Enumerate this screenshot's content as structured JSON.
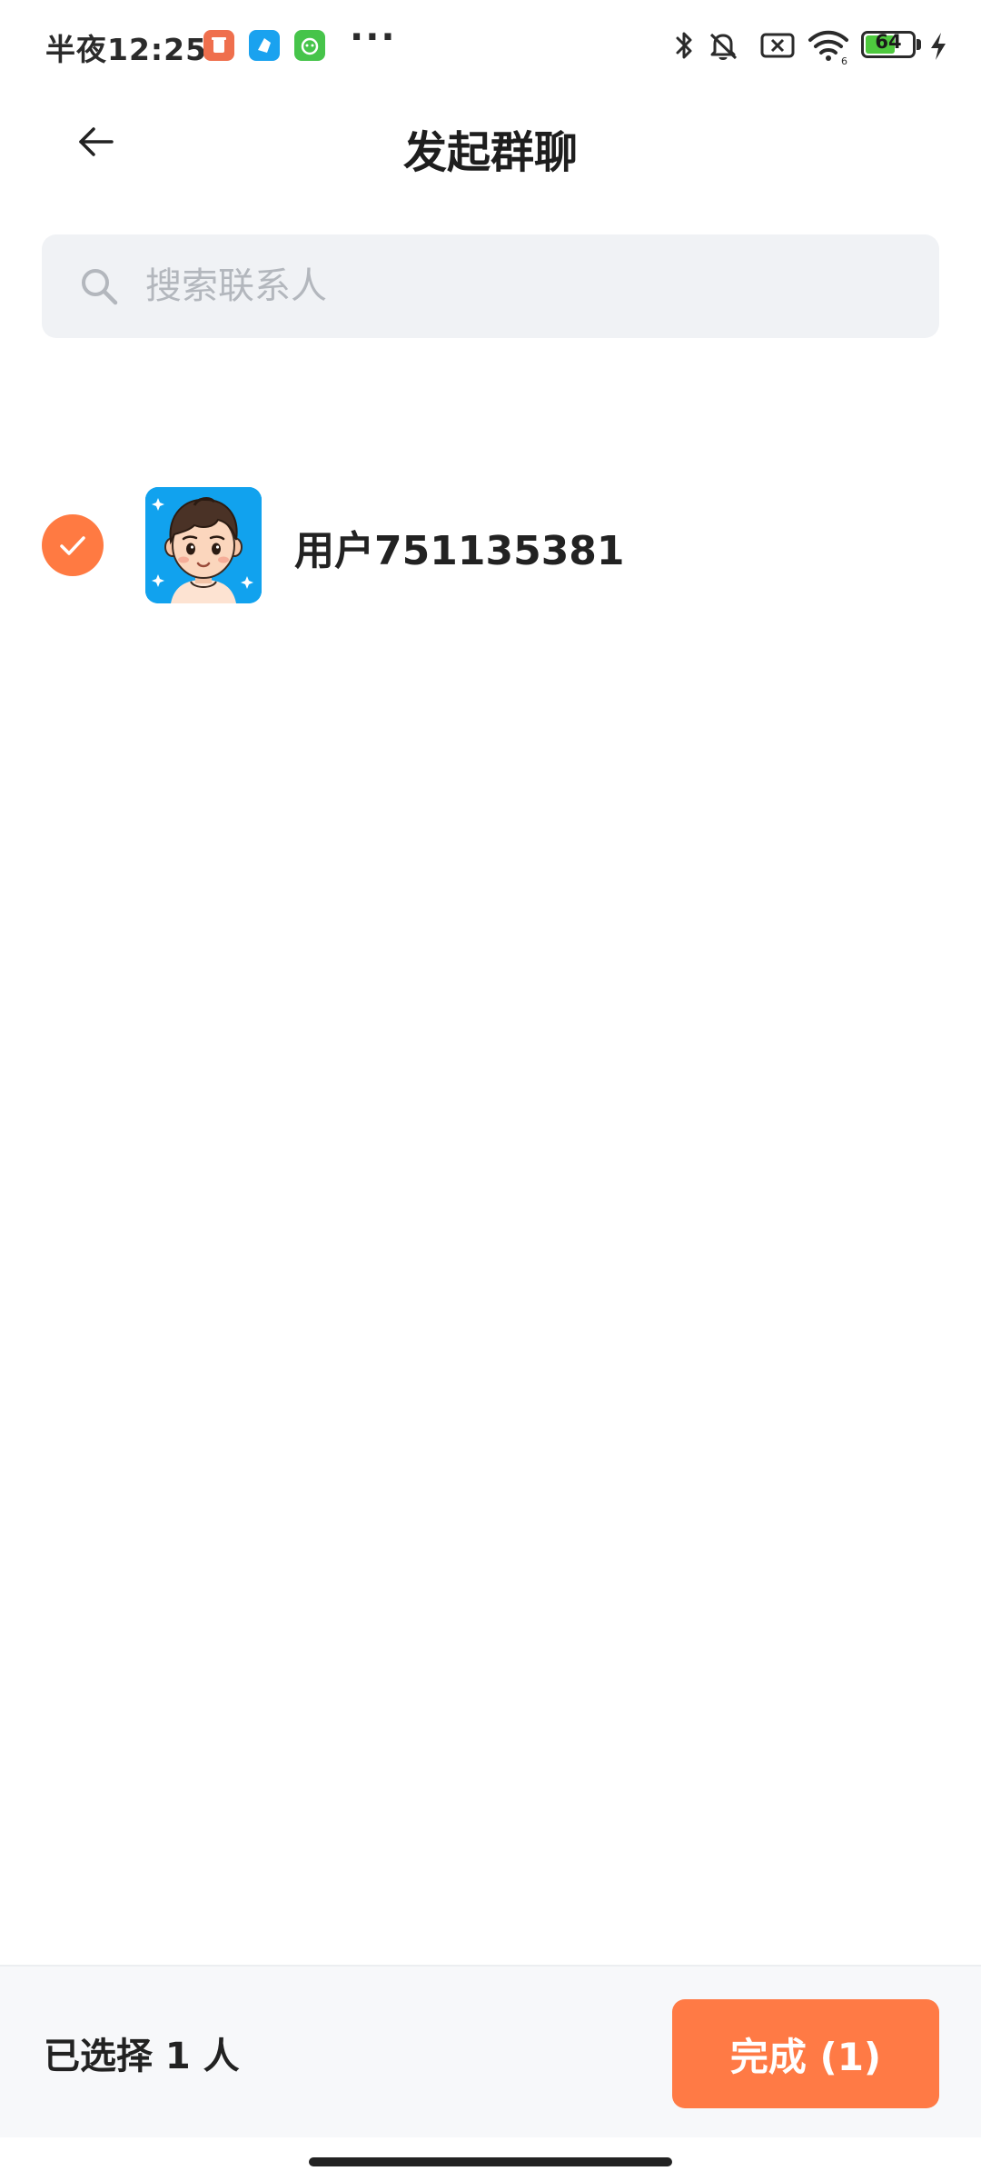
{
  "status_bar": {
    "time": "半夜12:25",
    "more": "···",
    "battery_level": "64",
    "battery_fraction": 0.64,
    "icons": [
      "notification-orange-icon",
      "notification-blue-icon",
      "notification-green-icon",
      "bluetooth-icon",
      "mute-icon",
      "no-sim-icon",
      "wifi-icon",
      "battery-icon",
      "charging-icon"
    ],
    "colors": {
      "notification_orange": "#ef6f4d",
      "notification_blue": "#1aa2ef",
      "notification_green": "#46c44a",
      "battery_fill": "#4ec93e"
    }
  },
  "header": {
    "title": "发起群聊",
    "back_icon": "arrow-left-icon"
  },
  "search": {
    "placeholder": "搜索联系人",
    "value": "",
    "icon": "search-icon"
  },
  "contacts": [
    {
      "name": "用户751135381",
      "selected": true,
      "avatar": "cartoon-boy-avatar"
    }
  ],
  "footer": {
    "selected_label": "已选择 1 人",
    "done_label": "完成 (1)"
  },
  "colors": {
    "accent": "#ff7a45",
    "search_bg": "#f0f2f5",
    "footer_bg": "#f7f8fa",
    "avatar_bg": "#11a2ee"
  }
}
